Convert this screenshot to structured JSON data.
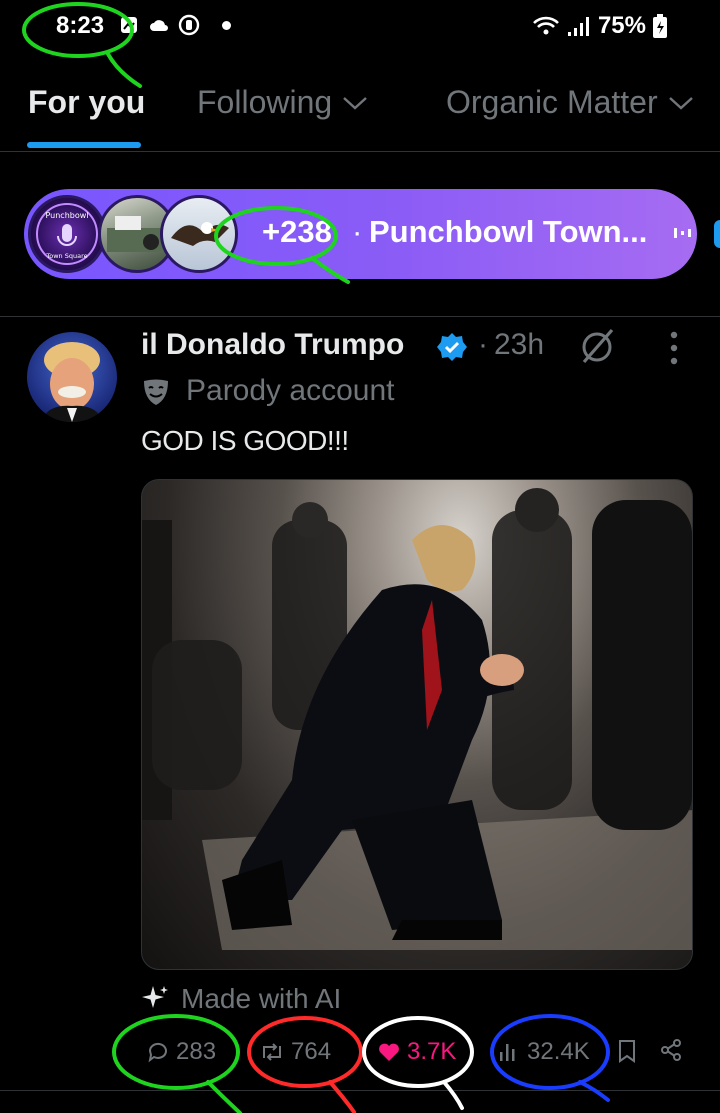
{
  "status_bar": {
    "time": "8:23",
    "battery": "75%"
  },
  "tabs": [
    {
      "label": "For you",
      "active": true
    },
    {
      "label": "Following",
      "active": false
    },
    {
      "label": "Organic Matter",
      "active": false
    }
  ],
  "space": {
    "listener_count": "+238",
    "separator": "·",
    "title": "Punchbowl Town...",
    "avatar_text_top": "Punchbowl",
    "avatar_text_bottom": "Town Square",
    "accent": "#7856ff"
  },
  "tweet": {
    "author_name": "il Donaldo Trumpo",
    "time": "23h",
    "meta_separator": "·",
    "parody_label": "Parody account",
    "text": "GOD IS GOOD!!!",
    "image_alt": "Man kneeling in prayer in a dim room",
    "ai_label": "Made with AI",
    "actions": {
      "replies": "283",
      "reposts": "764",
      "likes": "3.7K",
      "views": "32.4K"
    },
    "colors": {
      "verified": "#1d9bf0",
      "like": "#f91880",
      "muted": "#71767b"
    }
  },
  "annotations": {
    "green": "#1fd41f",
    "red": "#ff2a2a",
    "white": "#ffffff",
    "blue": "#1a3cff"
  }
}
